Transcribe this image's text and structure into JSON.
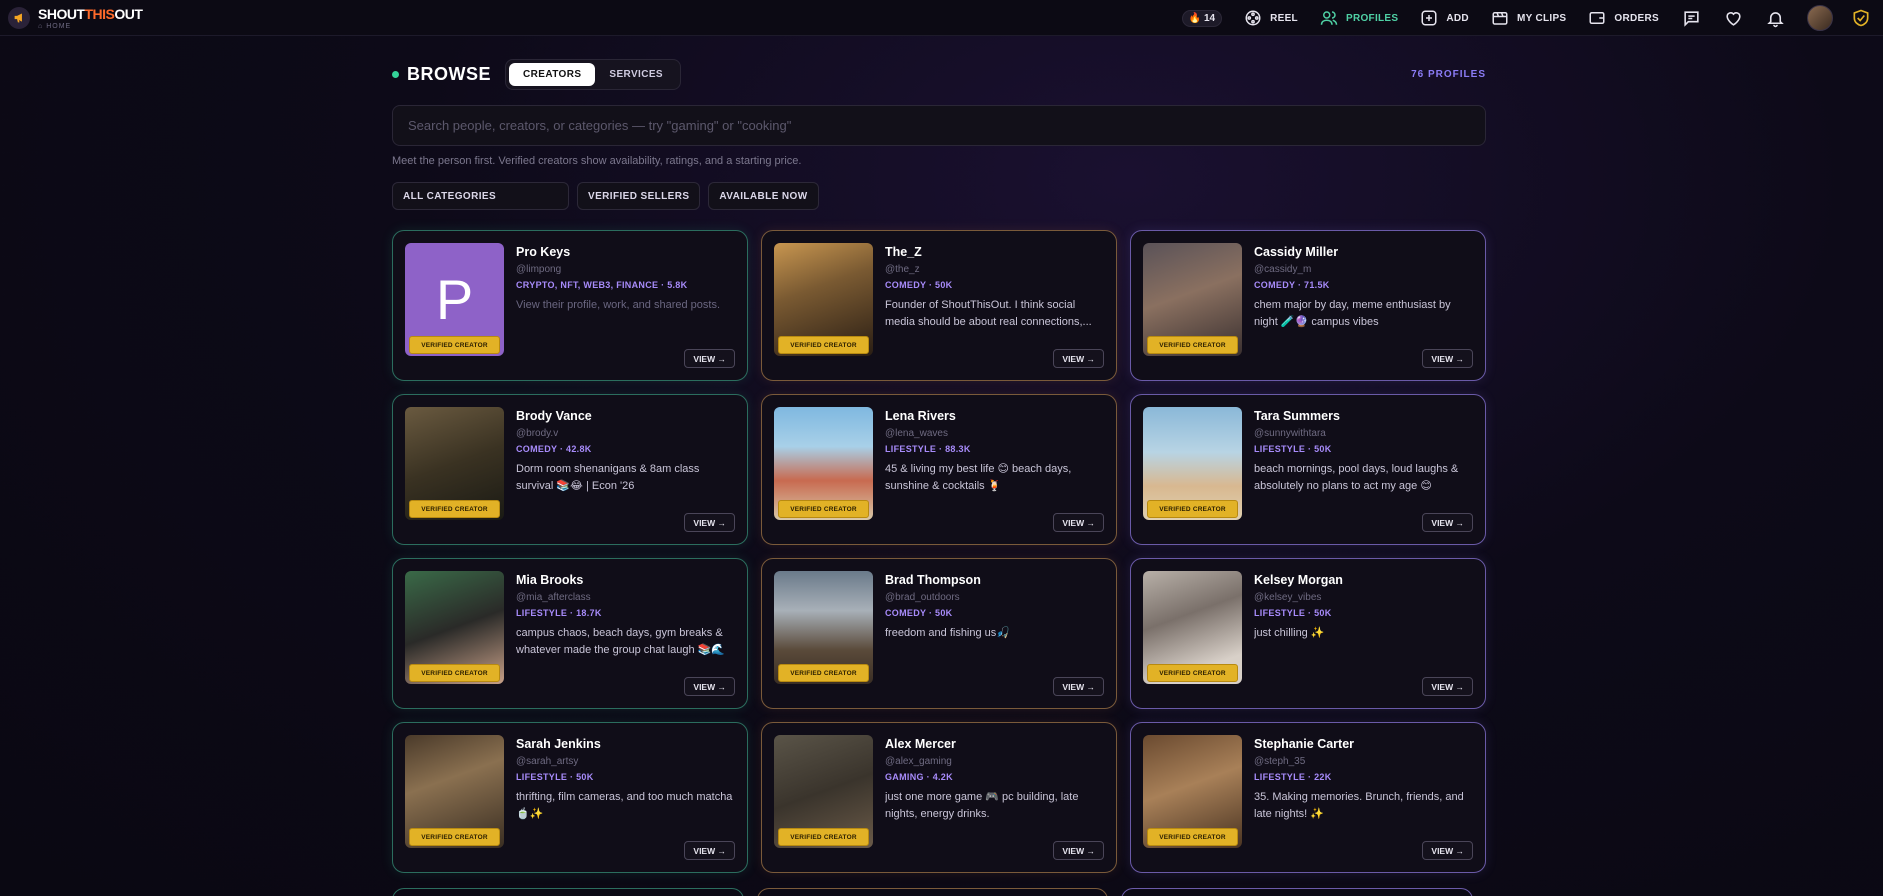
{
  "brand": {
    "name_part1": "SHOUT",
    "name_part2": "THIS",
    "name_part3": "OUT",
    "sub": "HOME"
  },
  "nav": {
    "coins": "14",
    "reel": "REEL",
    "profiles": "PROFILES",
    "add": "ADD",
    "my_clips": "MY CLIPS",
    "orders": "ORDERS"
  },
  "browse": {
    "title": "BROWSE",
    "tab_creators": "CREATORS",
    "tab_services": "SERVICES",
    "count": "76 PROFILES",
    "search_placeholder": "Search people, creators, or categories — try \"gaming\" or \"cooking\"",
    "hint": "Meet the person first. Verified creators show availability, ratings, and a starting price.",
    "filter_category": "ALL CATEGORIES",
    "filter_verified": "VERIFIED SELLERS",
    "filter_available": "AVAILABLE NOW"
  },
  "verified_label": "VERIFIED CREATOR",
  "view_label": "VIEW →",
  "creators": [
    {
      "name": "Pro Keys",
      "handle": "@limpong",
      "tags": "CRYPTO, NFT, WEB3, FINANCE · 5.8K",
      "bio": "View their profile, work, and shared posts.",
      "initial": "P"
    },
    {
      "name": "The_Z",
      "handle": "@the_z",
      "tags": "COMEDY · 50K",
      "bio": "Founder of ShoutThisOut. I think social media should be about real connections,..."
    },
    {
      "name": "Cassidy Miller",
      "handle": "@cassidy_m",
      "tags": "COMEDY · 71.5K",
      "bio": "chem major by day, meme enthusiast by night 🧪🔮 campus vibes"
    },
    {
      "name": "Brody Vance",
      "handle": "@brody.v",
      "tags": "COMEDY · 42.8K",
      "bio": "Dorm room shenanigans & 8am class survival 📚😂 | Econ '26"
    },
    {
      "name": "Lena Rivers",
      "handle": "@lena_waves",
      "tags": "LIFESTYLE · 88.3K",
      "bio": "45 & living my best life 😊 beach days, sunshine & cocktails 🍹"
    },
    {
      "name": "Tara Summers",
      "handle": "@sunnywithtara",
      "tags": "LIFESTYLE · 50K",
      "bio": "beach mornings, pool days, loud laughs & absolutely no plans to act my age 😊"
    },
    {
      "name": "Mia Brooks",
      "handle": "@mia_afterclass",
      "tags": "LIFESTYLE · 18.7K",
      "bio": "campus chaos, beach days, gym breaks & whatever made the group chat laugh 📚🌊"
    },
    {
      "name": "Brad Thompson",
      "handle": "@brad_outdoors",
      "tags": "COMEDY · 50K",
      "bio": "freedom and fishing us🎣"
    },
    {
      "name": "Kelsey Morgan",
      "handle": "@kelsey_vibes",
      "tags": "LIFESTYLE · 50K",
      "bio": "just chilling ✨"
    },
    {
      "name": "Sarah Jenkins",
      "handle": "@sarah_artsy",
      "tags": "LIFESTYLE · 50K",
      "bio": "thrifting, film cameras, and too much matcha 🍵✨"
    },
    {
      "name": "Alex Mercer",
      "handle": "@alex_gaming",
      "tags": "GAMING · 4.2K",
      "bio": "just one more game 🎮 pc building, late nights, energy drinks."
    },
    {
      "name": "Stephanie Carter",
      "handle": "@steph_35",
      "tags": "LIFESTYLE · 22K",
      "bio": "35. Making memories. Brunch, friends, and late nights! ✨"
    }
  ]
}
